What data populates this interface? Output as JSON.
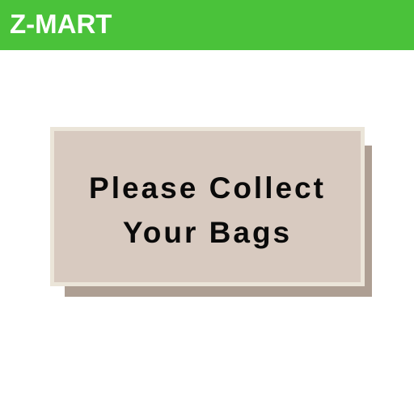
{
  "header": {
    "brand": "Z-MART"
  },
  "message": {
    "lines": [
      "Please Collect",
      "Your Bags"
    ]
  },
  "colors": {
    "header_background": "#4ac23a",
    "card_background": "#d8cac0",
    "card_border": "#ebe5d9",
    "card_shadow": "#ae9f93"
  }
}
